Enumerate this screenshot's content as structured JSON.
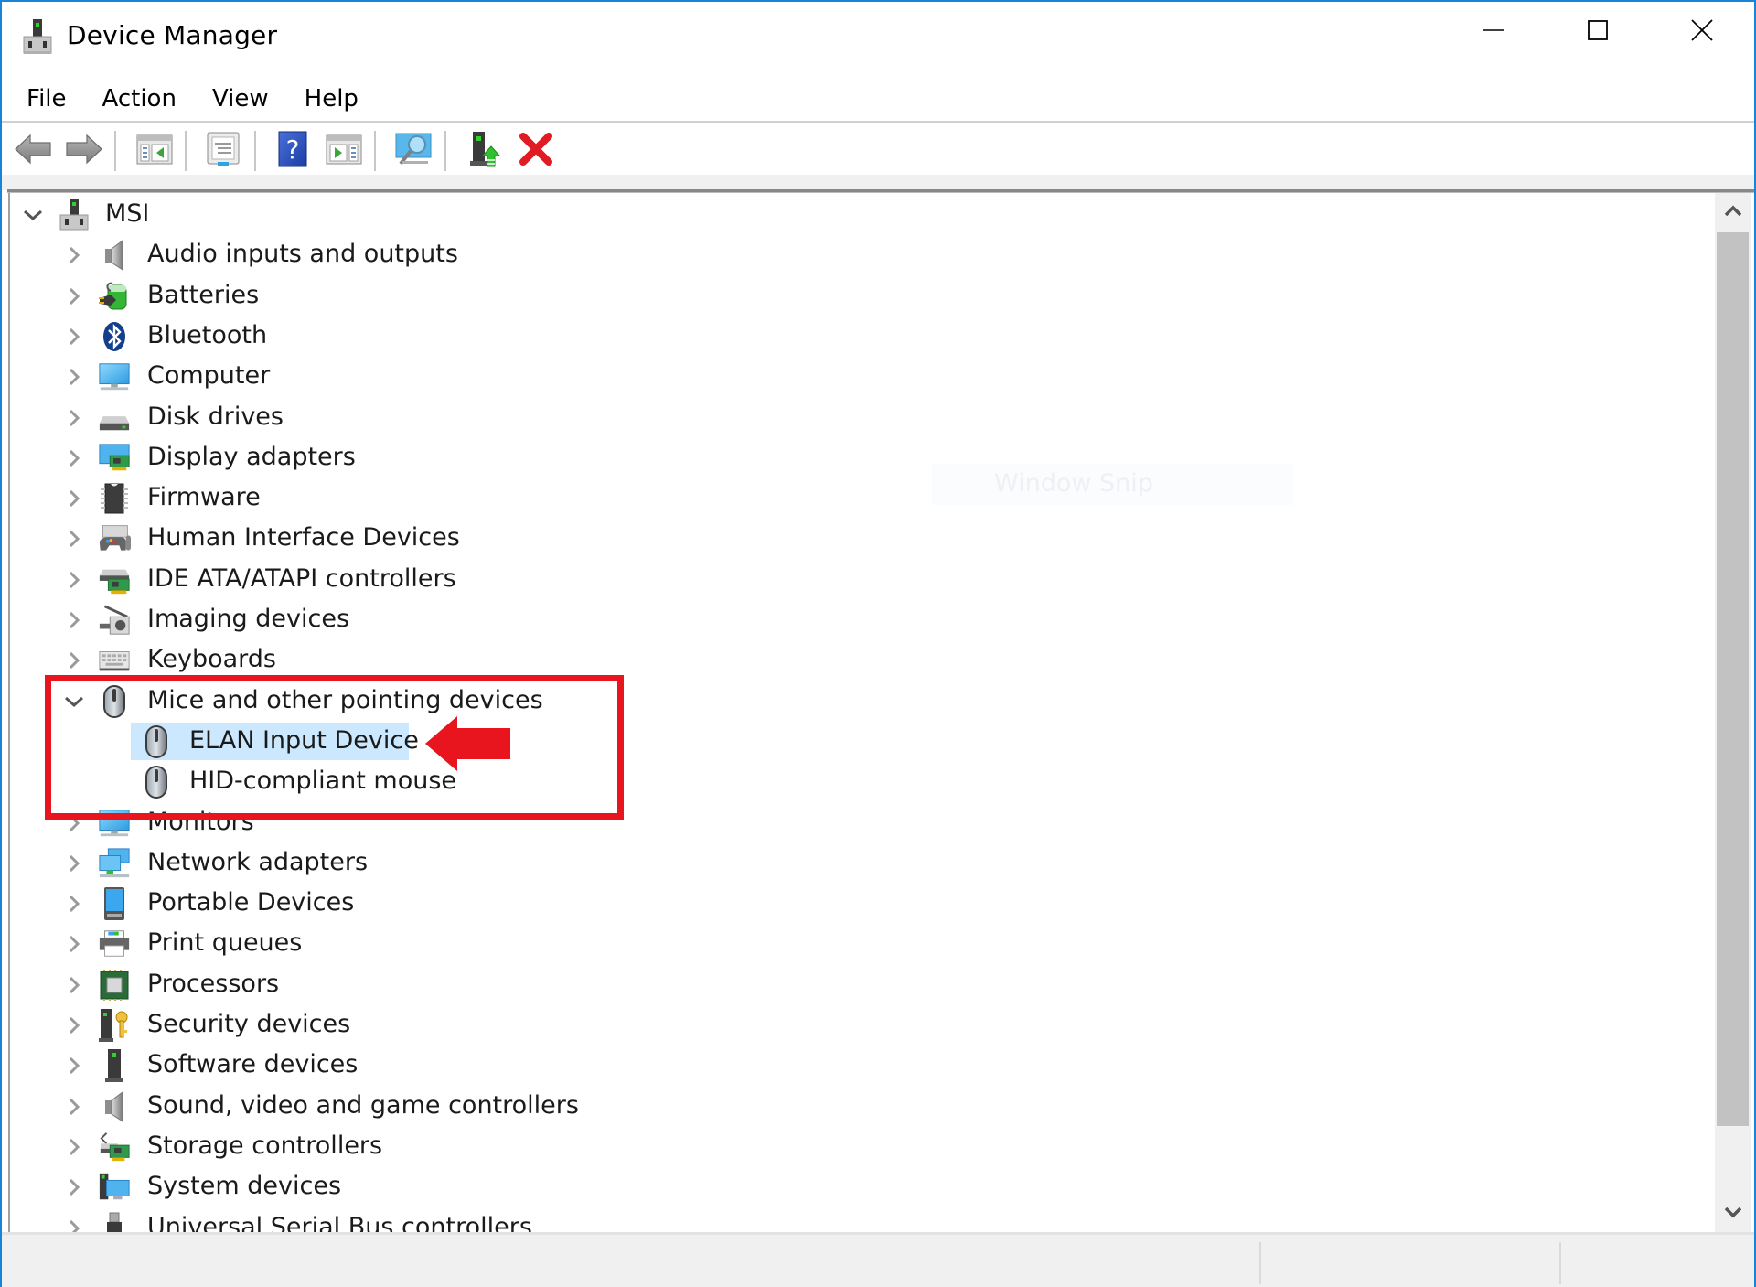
{
  "window": {
    "title": "Device Manager",
    "app_icon": "device-manager-icon",
    "controls": {
      "minimize": "minimize-icon",
      "maximize": "maximize-icon",
      "close": "close-icon"
    },
    "accent_color": "#1883d7"
  },
  "menu": {
    "items": [
      {
        "label": "File"
      },
      {
        "label": "Action"
      },
      {
        "label": "View"
      },
      {
        "label": "Help"
      }
    ]
  },
  "toolbar": {
    "buttons": [
      {
        "name": "back",
        "icon": "back-arrow-icon"
      },
      {
        "name": "forward",
        "icon": "forward-arrow-icon"
      },
      {
        "name": "show-hide-console-tree",
        "icon": "console-tree-icon"
      },
      {
        "name": "properties",
        "icon": "properties-icon"
      },
      {
        "name": "help",
        "icon": "help-icon"
      },
      {
        "name": "show-hide-action-pane",
        "icon": "action-pane-icon"
      },
      {
        "name": "scan-for-hardware-changes",
        "icon": "scan-hardware-icon"
      },
      {
        "name": "update-driver",
        "icon": "update-driver-icon"
      },
      {
        "name": "uninstall-device",
        "icon": "uninstall-icon"
      }
    ]
  },
  "tree": {
    "root": {
      "label": "MSI",
      "icon": "computer-root-icon",
      "expanded": true
    },
    "categories": [
      {
        "label": "Audio inputs and outputs",
        "icon": "speaker-icon",
        "expanded": false
      },
      {
        "label": "Batteries",
        "icon": "battery-icon",
        "expanded": false
      },
      {
        "label": "Bluetooth",
        "icon": "bluetooth-icon",
        "expanded": false
      },
      {
        "label": "Computer",
        "icon": "monitor-icon",
        "expanded": false
      },
      {
        "label": "Disk drives",
        "icon": "disk-drive-icon",
        "expanded": false
      },
      {
        "label": "Display adapters",
        "icon": "display-adapter-icon",
        "expanded": false
      },
      {
        "label": "Firmware",
        "icon": "firmware-chip-icon",
        "expanded": false
      },
      {
        "label": "Human Interface Devices",
        "icon": "hid-icon",
        "expanded": false
      },
      {
        "label": "IDE ATA/ATAPI controllers",
        "icon": "ide-controller-icon",
        "expanded": false
      },
      {
        "label": "Imaging devices",
        "icon": "camera-icon",
        "expanded": false
      },
      {
        "label": "Keyboards",
        "icon": "keyboard-icon",
        "expanded": false
      },
      {
        "label": "Mice and other pointing devices",
        "icon": "mouse-icon",
        "expanded": true,
        "children": [
          {
            "label": "ELAN Input Device",
            "icon": "mouse-icon",
            "selected": true
          },
          {
            "label": "HID-compliant mouse",
            "icon": "mouse-icon",
            "selected": false
          }
        ]
      },
      {
        "label": "Monitors",
        "icon": "monitor-icon",
        "expanded": false
      },
      {
        "label": "Network adapters",
        "icon": "network-adapter-icon",
        "expanded": false
      },
      {
        "label": "Portable Devices",
        "icon": "portable-device-icon",
        "expanded": false
      },
      {
        "label": "Print queues",
        "icon": "printer-icon",
        "expanded": false
      },
      {
        "label": "Processors",
        "icon": "processor-icon",
        "expanded": false
      },
      {
        "label": "Security devices",
        "icon": "security-key-icon",
        "expanded": false
      },
      {
        "label": "Software devices",
        "icon": "software-device-icon",
        "expanded": false
      },
      {
        "label": "Sound, video and game controllers",
        "icon": "speaker-icon",
        "expanded": false
      },
      {
        "label": "Storage controllers",
        "icon": "storage-controller-icon",
        "expanded": false
      },
      {
        "label": "System devices",
        "icon": "system-devices-icon",
        "expanded": false
      },
      {
        "label": "Universal Serial Bus controllers",
        "icon": "usb-icon",
        "expanded": false
      }
    ]
  },
  "watermark": {
    "text": "Window Snip"
  },
  "scrollbar": {
    "position_fraction": 0.0,
    "visible_fraction": 0.93
  },
  "annotation": {
    "highlight_color": "#e8141e",
    "box_target": "Mice and other pointing devices",
    "arrow_target": "ELAN Input Device"
  }
}
